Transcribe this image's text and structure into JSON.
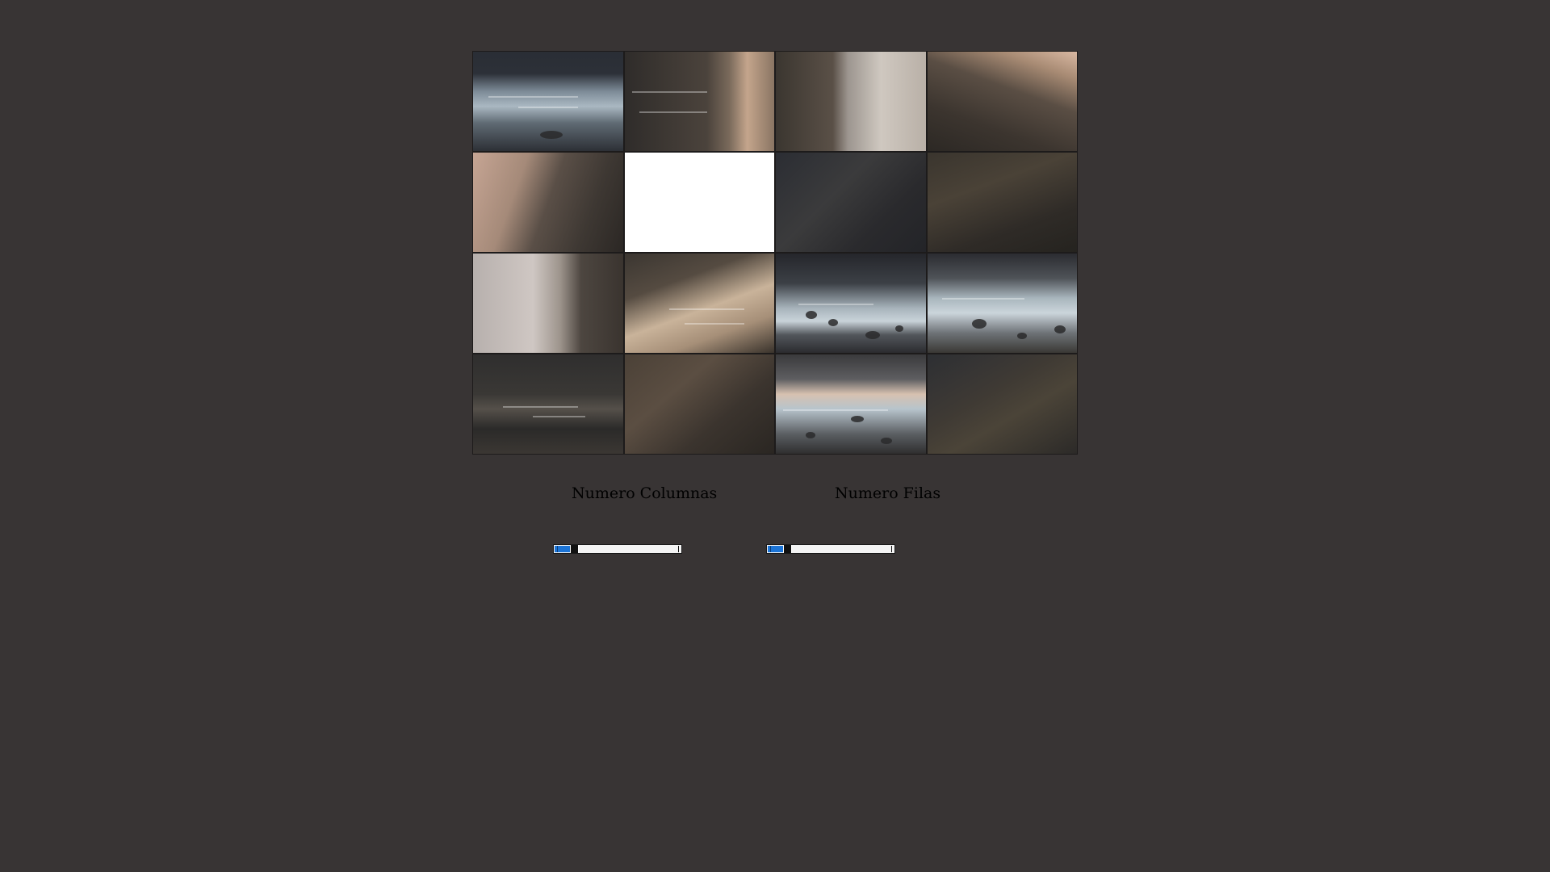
{
  "puzzle": {
    "grid": {
      "columns": 4,
      "rows": 4
    },
    "tiles": [
      {
        "id": 1,
        "texture": "t-sea-dark",
        "empty": false
      },
      {
        "id": 2,
        "texture": "t-wet-sand",
        "empty": false
      },
      {
        "id": 3,
        "texture": "t-cliff-sky",
        "empty": false
      },
      {
        "id": 4,
        "texture": "t-cliff-sunset",
        "empty": false
      },
      {
        "id": 5,
        "texture": "t-cliff-left",
        "empty": false
      },
      {
        "id": 6,
        "texture": "",
        "empty": true
      },
      {
        "id": 7,
        "texture": "t-rock-dark1",
        "empty": false
      },
      {
        "id": 8,
        "texture": "t-rock-dark2",
        "empty": false
      },
      {
        "id": 9,
        "texture": "t-sky-cliff",
        "empty": false
      },
      {
        "id": 10,
        "texture": "t-sand-pale",
        "empty": false
      },
      {
        "id": 11,
        "texture": "t-surf-rocks",
        "empty": false
      },
      {
        "id": 12,
        "texture": "t-surf-rocks2",
        "empty": false
      },
      {
        "id": 13,
        "texture": "t-dark-sand",
        "empty": false
      },
      {
        "id": 14,
        "texture": "t-rock-brown",
        "empty": false
      },
      {
        "id": 15,
        "texture": "t-surf-sunset",
        "empty": false
      },
      {
        "id": 16,
        "texture": "t-rock-moss",
        "empty": false
      }
    ]
  },
  "controls": {
    "columns_label": "Numero Columnas",
    "rows_label": "Numero Filas",
    "columns_slider": {
      "level": 0.12
    },
    "rows_slider": {
      "level": 0.12
    }
  },
  "colors": {
    "background": "#383434",
    "slider_fill": "#1c74d6",
    "empty_tile": "#ffffff"
  }
}
